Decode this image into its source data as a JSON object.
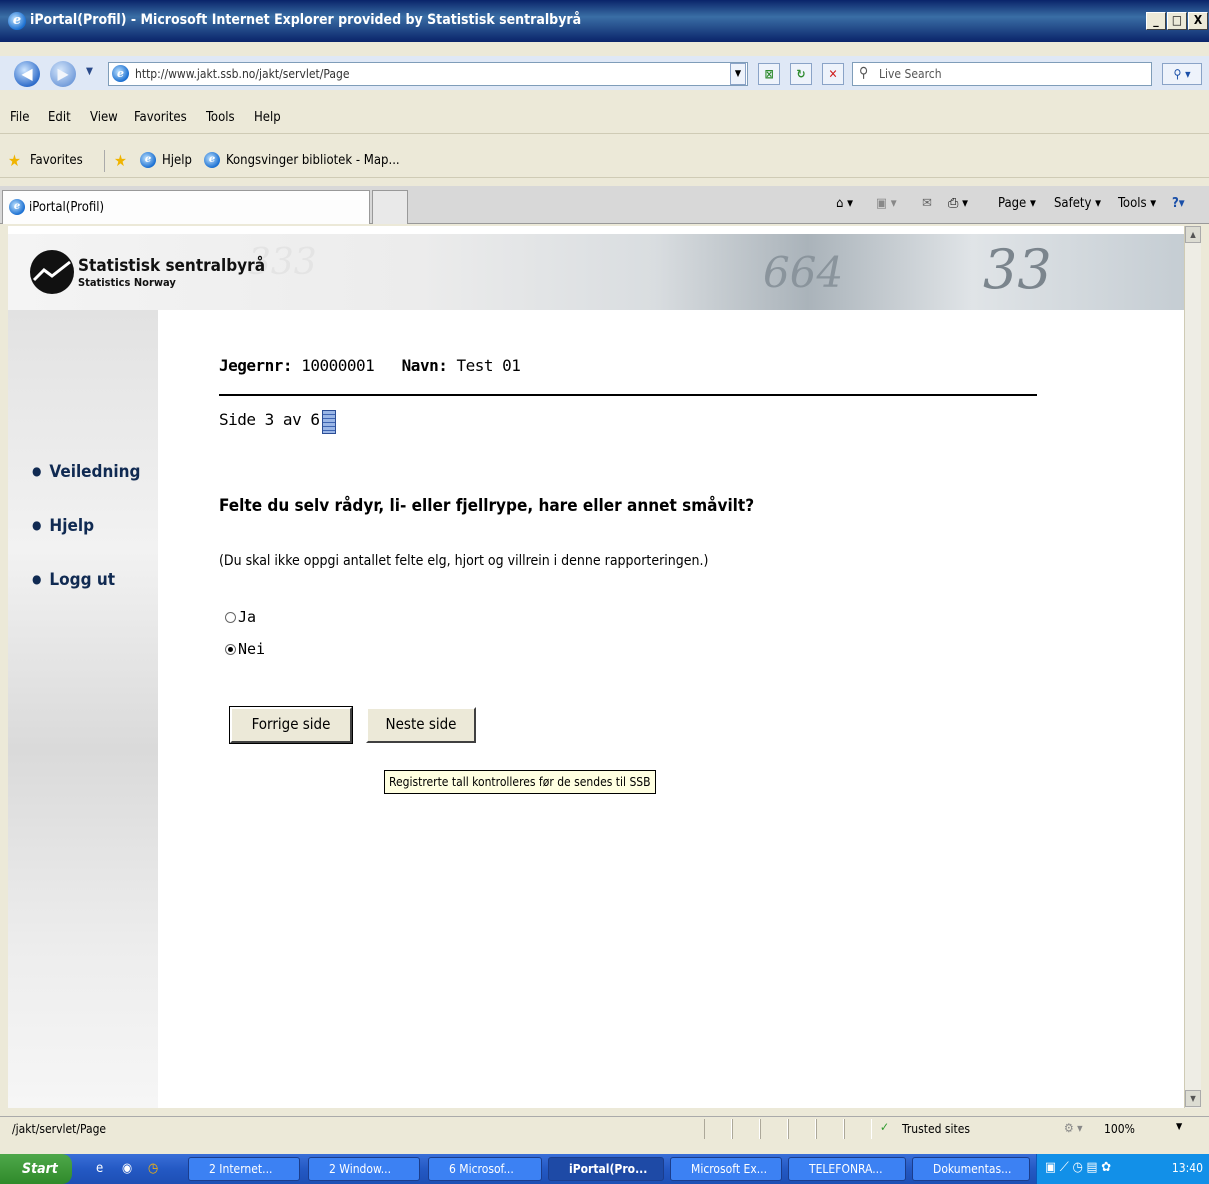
{
  "window": {
    "title": "iPortal(Profil) - Microsoft Internet Explorer provided by Statistisk sentralbyrå",
    "min": "_",
    "max": "□",
    "close": "X"
  },
  "address": {
    "url": "http://www.jakt.ssb.no/jakt/servlet/Page"
  },
  "search": {
    "placeholder": "Live Search"
  },
  "menu": [
    "File",
    "Edit",
    "View",
    "Favorites",
    "Tools",
    "Help"
  ],
  "favorites": {
    "label": "Favorites",
    "links": [
      "Hjelp",
      "Kongsvinger bibliotek - Map..."
    ]
  },
  "tab": {
    "label": "iPortal(Profil)"
  },
  "commandbar": {
    "page": "Page ▾",
    "safety": "Safety ▾",
    "tools": "Tools ▾"
  },
  "site": {
    "logo_name": "Statistisk sentralbyrå",
    "logo_sub": "Statistics Norway",
    "banner_num1": "664",
    "banner_num2": "33",
    "banner_num3": "333"
  },
  "nav": [
    "Veiledning",
    "Hjelp",
    "Logg ut"
  ],
  "form": {
    "jegernr_label": "Jegernr:",
    "jegernr_value": "10000001",
    "navn_label": "Navn:",
    "navn_value": "Test 01",
    "page_indicator": "Side 3 av 6",
    "question": "Felte du selv rådyr, li- eller fjellrype, hare eller annet småvilt?",
    "note": "(Du skal ikke oppgi antallet felte elg, hjort og villrein i denne rapporteringen.)",
    "options": [
      {
        "label": "Ja",
        "selected": false
      },
      {
        "label": "Nei",
        "selected": true
      }
    ],
    "prev_button": "Forrige side",
    "next_button": "Neste side",
    "tooltip": "Registrerte tall kontrolleres før de sendes til SSB"
  },
  "status": {
    "path": "/jakt/servlet/Page",
    "zone": "Trusted sites",
    "zoom": "100%"
  },
  "taskbar": {
    "start": "Start",
    "tasks": [
      "2 Internet...",
      "2 Window...",
      "6 Microsof...",
      "iPortal(Pro...",
      "Microsoft Ex...",
      "TELEFONRA...",
      "Dokumentas..."
    ],
    "clock": "13:40"
  }
}
